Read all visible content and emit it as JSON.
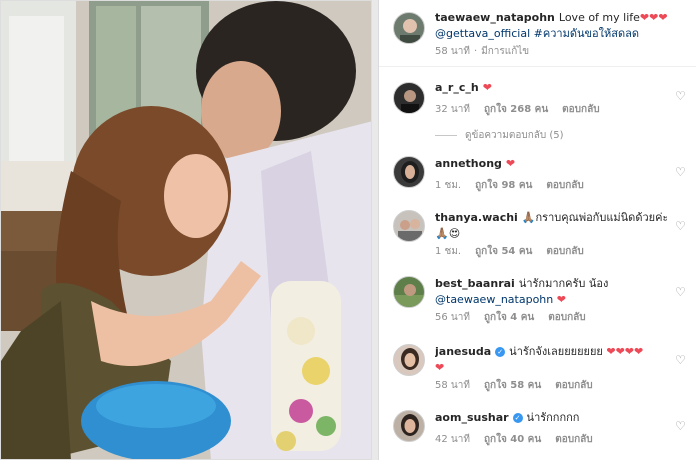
{
  "post": {
    "author": "taewaew_natapohn",
    "caption_text": "Love of my life",
    "caption_hearts": "❤❤❤❤",
    "mention": "@gettava_official",
    "hashtag": "#ความดันขอให้สดลด",
    "time": "58 นาที",
    "edited": "มีการแก้ไข"
  },
  "view_replies": "ดูข้อความตอบกลับ (5)",
  "comments": [
    {
      "username": "a_r_c_h",
      "text": "",
      "hearts": "❤",
      "time": "32 นาที",
      "likes": "ถูกใจ 268 คน",
      "reply": "ตอบกลับ",
      "verified": false
    },
    {
      "username": "annethong",
      "text": "",
      "hearts": "❤",
      "time": "1 ชม.",
      "likes": "ถูกใจ 98 คน",
      "reply": "ตอบกลับ",
      "verified": false
    },
    {
      "username": "thanya.wachi",
      "text": "🙏🏽กราบคุณพ่อกับแม่นิดด้วยค่ะ",
      "text2": "🙏🏽😍",
      "time": "1 ชม.",
      "likes": "ถูกใจ 54 คน",
      "reply": "ตอบกลับ",
      "verified": false
    },
    {
      "username": "best_baanrai",
      "text": "น่ารักมากครับ น้อง",
      "mention": "@taewaew_natapohn",
      "hearts": "❤",
      "time": "56 นาที",
      "likes": "ถูกใจ 4 คน",
      "reply": "ตอบกลับ",
      "verified": false
    },
    {
      "username": "janesuda",
      "text": "น่ารักจังเลยยยยยยย",
      "hearts": "❤❤❤❤",
      "hearts2": "❤",
      "time": "58 นาที",
      "likes": "ถูกใจ 58 คน",
      "reply": "ตอบกลับ",
      "verified": true
    },
    {
      "username": "aom_sushar",
      "text": "น่ารักกกกก",
      "time": "42 นาที",
      "likes": "ถูกใจ 40 คน",
      "reply": "ตอบกลับ",
      "verified": true
    }
  ],
  "icons": {
    "like": "heart-outline-icon",
    "verified": "verified-badge-icon"
  },
  "colors": {
    "heart": "#ed4956",
    "link": "#00376b",
    "verified": "#3897f0"
  }
}
